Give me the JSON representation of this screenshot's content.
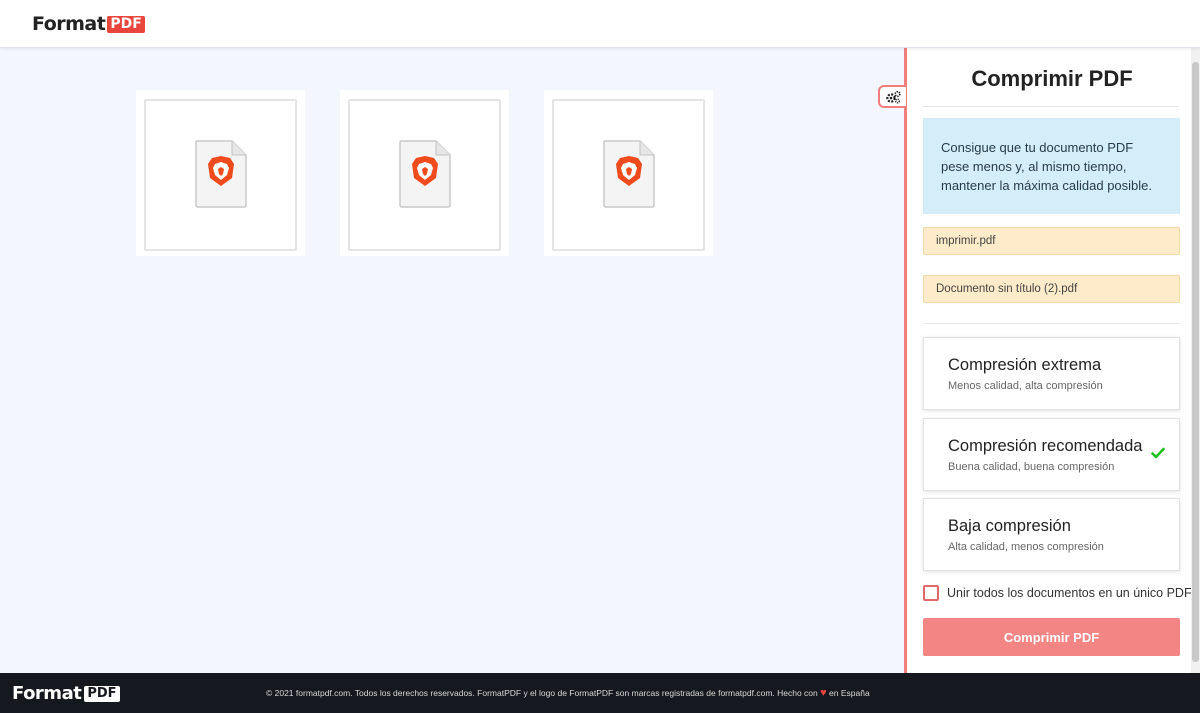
{
  "header": {
    "logo_word": "Format",
    "logo_badge": "PDF"
  },
  "thumbnails": [
    {
      "icon": "pdf-file-icon"
    },
    {
      "icon": "pdf-file-icon"
    },
    {
      "icon": "pdf-file-icon"
    }
  ],
  "settings_toggle": {
    "icon": "gears-icon"
  },
  "sidebar": {
    "title": "Comprimir PDF",
    "info": "Consigue que tu documento PDF pese menos y, al mismo tiempo, mantener la máxima calidad posible.",
    "files": [
      "imprimir.pdf",
      "Documento sin título (2).pdf"
    ],
    "options": [
      {
        "title": "Compresión extrema",
        "subtitle": "Menos calidad, alta compresión",
        "selected": false
      },
      {
        "title": "Compresión recomendada",
        "subtitle": "Buena calidad, buena compresión",
        "selected": true
      },
      {
        "title": "Baja compresión",
        "subtitle": "Alta calidad, menos compresión",
        "selected": false
      }
    ],
    "merge_label": "Unir todos los documentos en un único PDF.",
    "merge_checked": false,
    "submit_label": "Comprimir PDF"
  },
  "footer": {
    "logo_word": "Format",
    "logo_badge": "PDF",
    "text_before": "© 2021 formatpdf.com. Todos los derechos reservados. FormatPDF y el logo de FormatPDF son marcas registradas de formatpdf.com. Hecho con",
    "text_after": "en España"
  },
  "colors": {
    "accent": "#f17d7d",
    "button": "#f48585",
    "info_bg": "#d3eef8",
    "file_chip_bg": "#fdebc9",
    "check": "#1ec31e"
  }
}
